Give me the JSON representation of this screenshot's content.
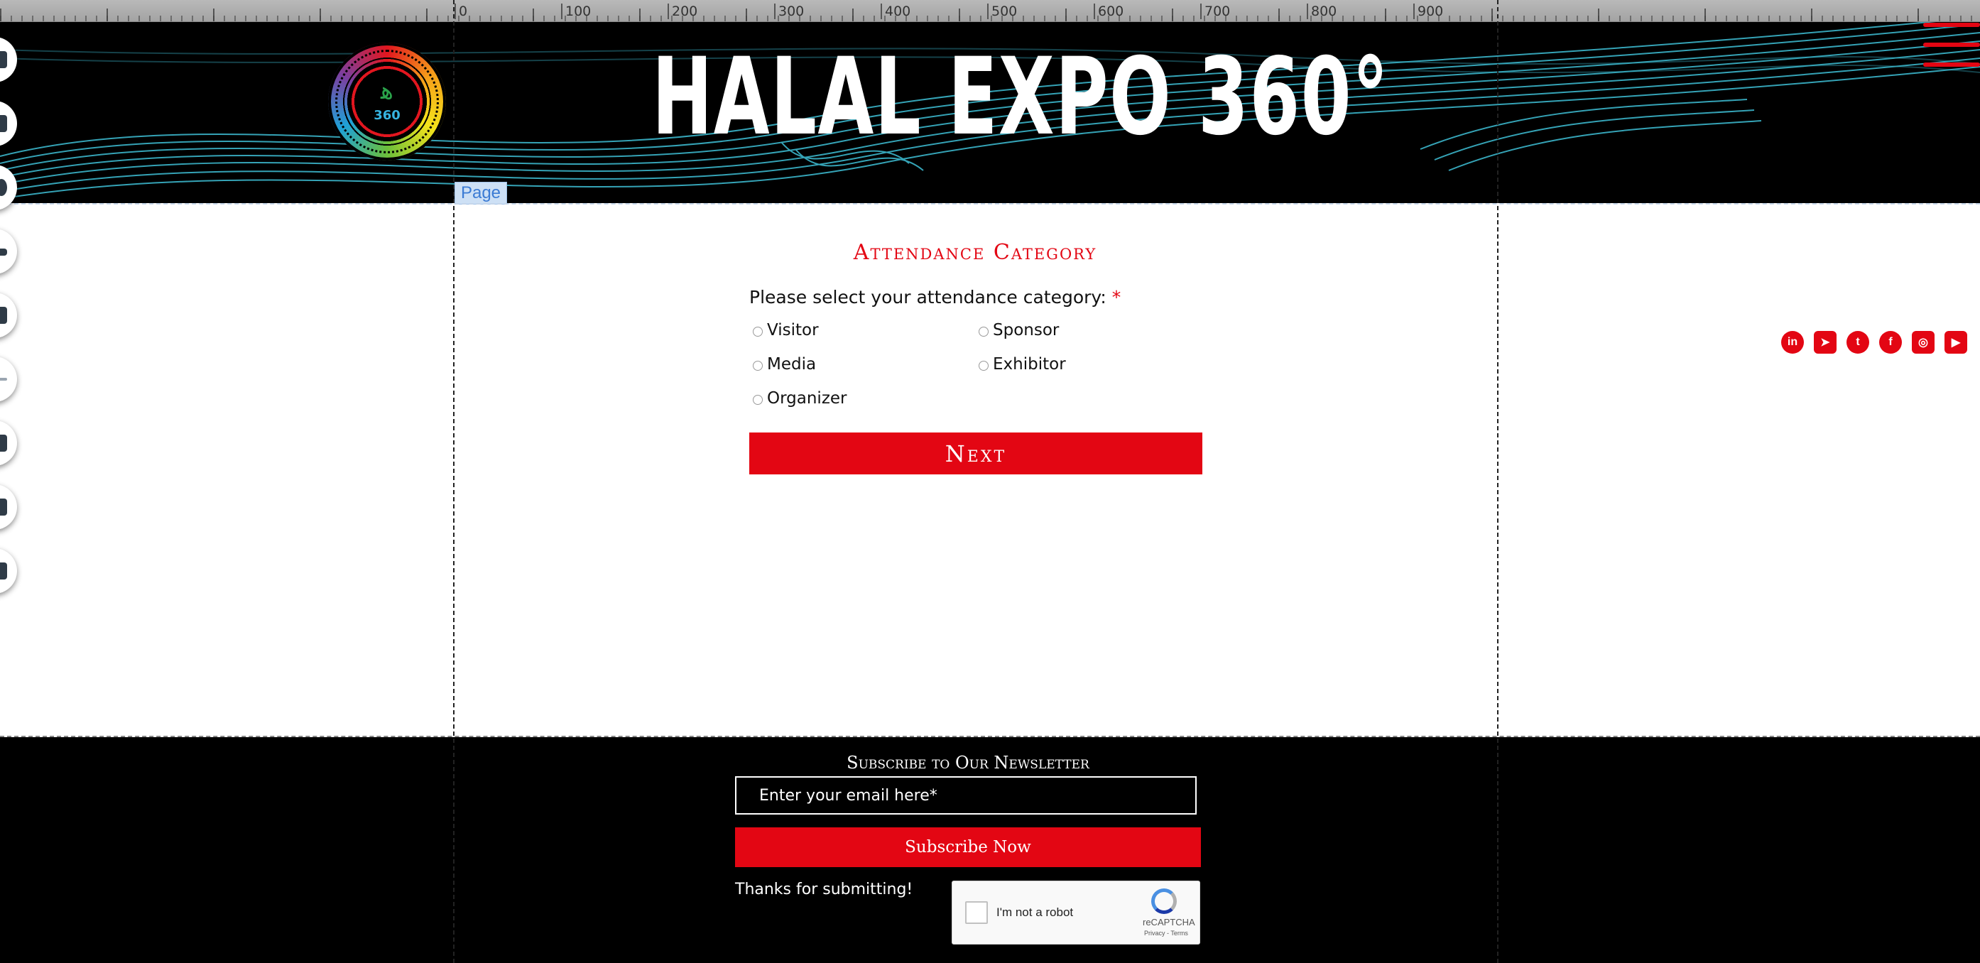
{
  "ruler": {
    "labels": [
      "0",
      "100",
      "200",
      "300",
      "400",
      "500",
      "600",
      "700",
      "800",
      "900"
    ]
  },
  "header": {
    "title": "HALAL EXPO 360°",
    "logo_text": "360",
    "page_tag": "Page"
  },
  "form": {
    "title": "Attendance Category",
    "question": "Please select your attendance category:",
    "required_mark": "*",
    "options": [
      "Visitor",
      "Sponsor",
      "Media",
      "Exhibitor",
      "Organizer"
    ],
    "next_label": "Next"
  },
  "social": {
    "items": [
      {
        "name": "linkedin-icon",
        "glyph": "in"
      },
      {
        "name": "telegram-icon",
        "glyph": "➤"
      },
      {
        "name": "twitter-icon",
        "glyph": "t"
      },
      {
        "name": "facebook-icon",
        "glyph": "f"
      },
      {
        "name": "instagram-icon",
        "glyph": "◎"
      },
      {
        "name": "youtube-icon",
        "glyph": "▶"
      }
    ]
  },
  "newsletter": {
    "title": "Subscribe to Our Newsletter",
    "email_placeholder": "Enter your email here*",
    "subscribe_label": "Subscribe Now",
    "thanks": "Thanks for submitting!"
  },
  "captcha": {
    "label": "I'm not a robot",
    "brand": "reCAPTCHA",
    "links": "Privacy - Terms"
  },
  "colors": {
    "accent": "#e30613",
    "header_bg": "#000000",
    "wave": "#3fc0d6"
  }
}
